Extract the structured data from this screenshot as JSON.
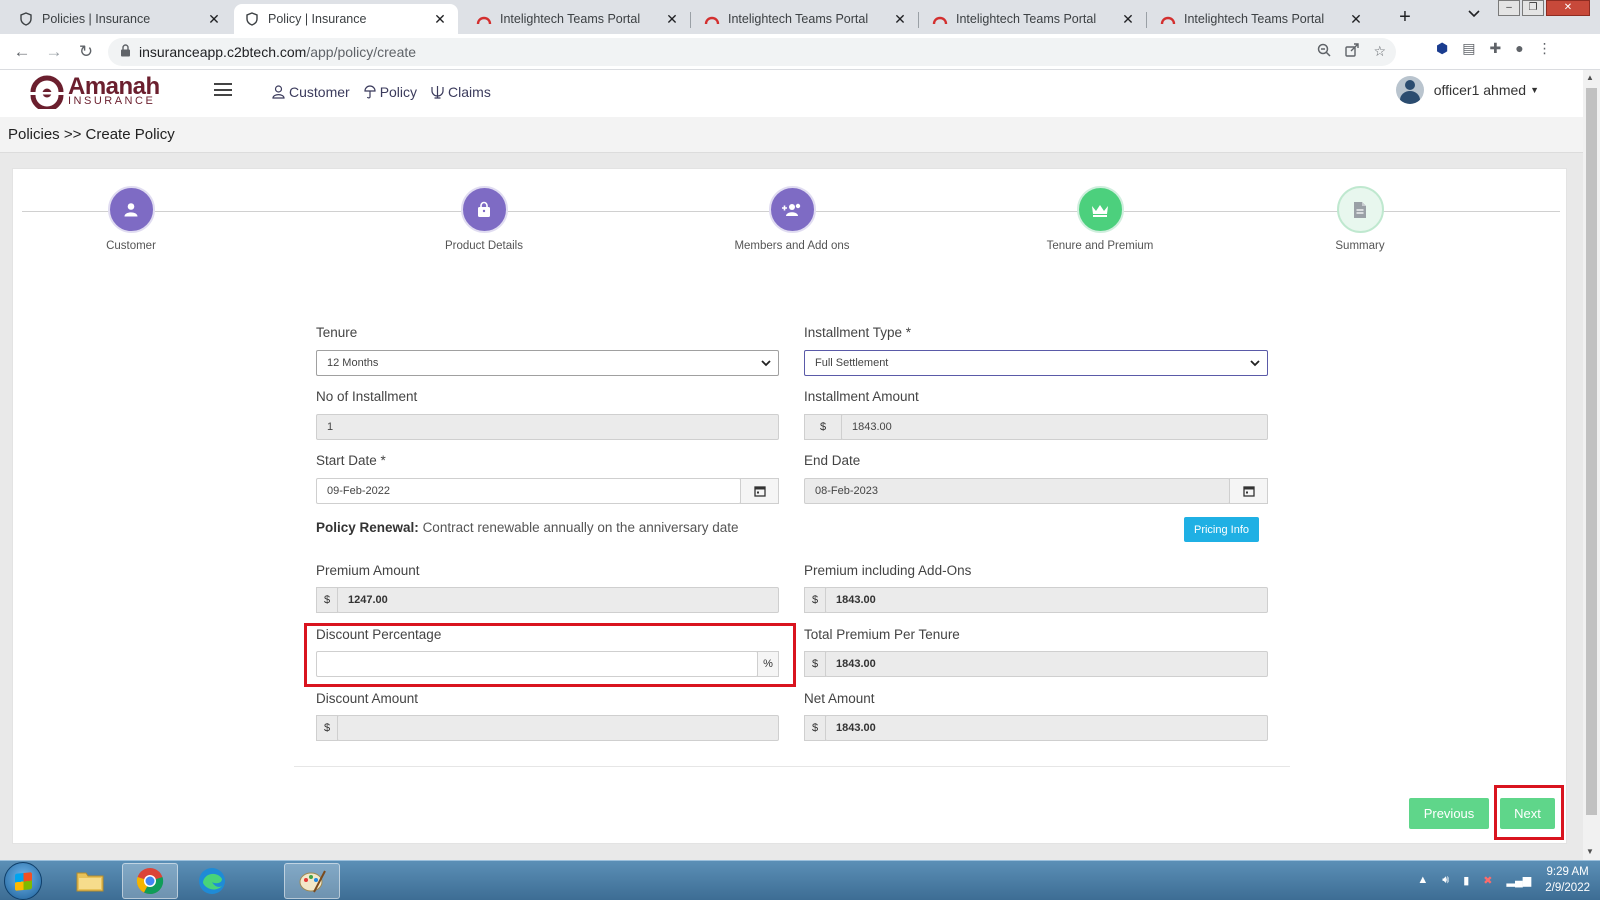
{
  "browser": {
    "tabs": [
      {
        "title": "Policies | Insurance",
        "icon": "shield-icon",
        "active": false
      },
      {
        "title": "Policy | Insurance",
        "icon": "shield-icon",
        "active": true
      },
      {
        "title": "Intelightech Teams Portal",
        "icon": "teams-portal-icon",
        "active": false
      },
      {
        "title": "Intelightech Teams Portal",
        "icon": "teams-portal-icon",
        "active": false
      },
      {
        "title": "Intelightech Teams Portal",
        "icon": "teams-portal-icon",
        "active": false
      },
      {
        "title": "Intelightech Teams Portal",
        "icon": "teams-portal-icon",
        "active": false
      }
    ],
    "url_host": "insuranceapp.c2btech.com",
    "url_path": "/app/policy/create"
  },
  "header": {
    "logo_word": "Amanah",
    "logo_sub": "INSURANCE",
    "nav": [
      {
        "label": "Customer",
        "icon": "user-icon"
      },
      {
        "label": "Policy",
        "icon": "umbrella-icon"
      },
      {
        "label": "Claims",
        "icon": "claims-icon"
      }
    ],
    "user_name": "officer1 ahmed"
  },
  "breadcrumb": "Policies >> Create Policy",
  "steps": [
    {
      "label": "Customer",
      "icon": "user-icon",
      "state": "done"
    },
    {
      "label": "Product Details",
      "icon": "bag-icon",
      "state": "done"
    },
    {
      "label": "Members and Add ons",
      "icon": "users-plus-icon",
      "state": "done"
    },
    {
      "label": "Tenure and Premium",
      "icon": "crown-icon",
      "state": "current"
    },
    {
      "label": "Summary",
      "icon": "document-icon",
      "state": "pending"
    }
  ],
  "form": {
    "tenure": {
      "label": "Tenure",
      "value": "12 Months"
    },
    "installment_type": {
      "label": "Installment Type *",
      "value": "Full Settlement"
    },
    "no_of_installment": {
      "label": "No of Installment",
      "value": "1"
    },
    "installment_amount": {
      "label": "Installment Amount",
      "currency": "$",
      "value": "1843.00"
    },
    "start_date": {
      "label": "Start Date *",
      "value": "09-Feb-2022"
    },
    "end_date": {
      "label": "End Date",
      "value": "08-Feb-2023"
    },
    "policy_renewal": {
      "label": "Policy Renewal:",
      "text": "Contract renewable annually on the anniversary date"
    },
    "pricing_info_label": "Pricing Info",
    "premium_amount": {
      "label": "Premium Amount",
      "currency": "$",
      "value": "1247.00"
    },
    "premium_incl_addons": {
      "label": "Premium including Add-Ons",
      "currency": "$",
      "value": "1843.00"
    },
    "discount_percentage": {
      "label": "Discount Percentage",
      "value": "",
      "suffix": "%"
    },
    "total_premium_per_tenure": {
      "label": "Total Premium Per Tenure",
      "currency": "$",
      "value": "1843.00"
    },
    "discount_amount": {
      "label": "Discount Amount",
      "currency": "$",
      "value": ""
    },
    "net_amount": {
      "label": "Net Amount",
      "currency": "$",
      "value": "1843.00"
    }
  },
  "actions": {
    "previous_label": "Previous",
    "next_label": "Next"
  },
  "taskbar": {
    "time": "9:29 AM",
    "date": "2/9/2022"
  },
  "colors": {
    "step_done": "#7e6bc4",
    "step_current": "#4cd07d",
    "button_green": "#5fd68a",
    "pricing_btn": "#1fb0e4",
    "highlight": "#d9141f"
  }
}
